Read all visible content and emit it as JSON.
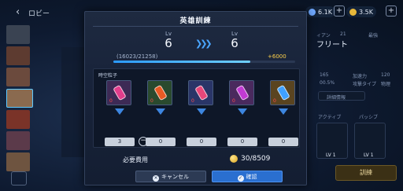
{
  "topbar": {
    "back_label": "ロビー",
    "resource_1": "6.1K",
    "resource_2": "3.5K"
  },
  "side_panel": {
    "name": "フリート",
    "rows": [
      "ィアン",
      "21",
      "最強",
      "165",
      "加速力",
      "120",
      "00.5%",
      "攻撃タイプ",
      "物理"
    ],
    "details_label": "詳細情報",
    "skill_tabs": [
      "アクティブ",
      "パッシブ"
    ],
    "skill_levels": [
      "LV 1",
      "LV 1"
    ],
    "train_button": "訓練"
  },
  "dialog": {
    "title": "英雄訓練",
    "lv_label": "Lv",
    "lv_from": "6",
    "lv_to": "6",
    "exp_text": "(16023/21258)",
    "exp_progress": 0.754,
    "exp_bonus": "+6000",
    "items_label": "時空粒子",
    "items": [
      {
        "count": "0",
        "qty": "3",
        "color": "#e23d8c"
      },
      {
        "count": "0",
        "qty": "0",
        "color": "#e85a24"
      },
      {
        "count": "0",
        "qty": "0",
        "color": "#e7477a"
      },
      {
        "count": "0",
        "qty": "0",
        "color": "#c13ad2"
      },
      {
        "count": "0",
        "qty": "0",
        "color": "#3fa0ff"
      }
    ],
    "cost_label": "必要費用",
    "cost_value": "30/8509",
    "cancel_label": "キャンセル",
    "confirm_label": "確認"
  }
}
